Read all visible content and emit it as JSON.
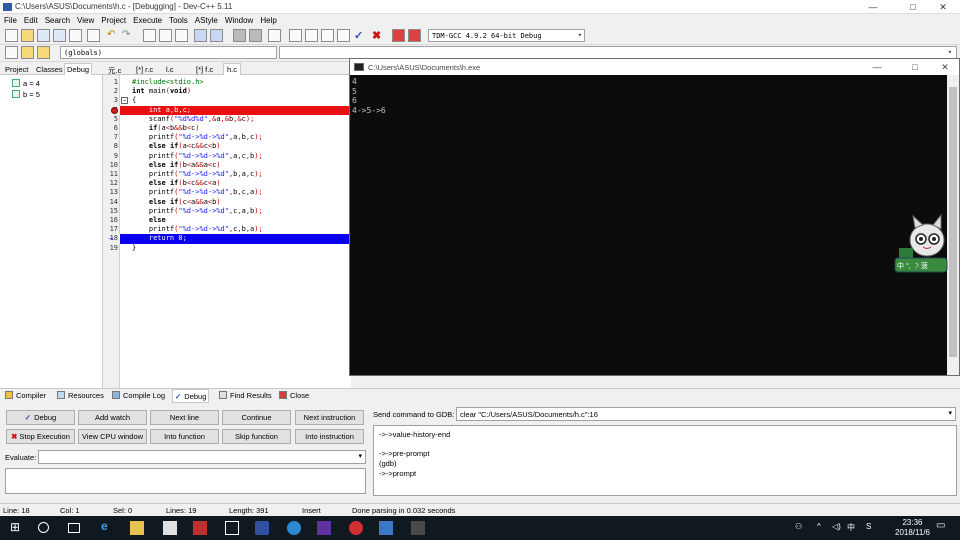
{
  "window": {
    "title": "C:\\Users\\ASUS\\Documents\\h.c - [Debugging] - Dev-C++ 5.11",
    "minimize": "—",
    "maximize": "□",
    "close": "✕"
  },
  "menu": [
    "File",
    "Edit",
    "Search",
    "View",
    "Project",
    "Execute",
    "Tools",
    "AStyle",
    "Window",
    "Help"
  ],
  "toolbar": {
    "compiler": "TDM-GCC 4.9.2 64-bit Debug",
    "scope": "(globals)"
  },
  "left_panel": {
    "tabs": [
      "Project",
      "Classes",
      "Debug"
    ],
    "active_tab": "Debug",
    "watches": [
      "a = 4",
      "b = 5"
    ]
  },
  "editor": {
    "tabs": [
      "元.c",
      "[*] r.c",
      "l.c",
      "[*] f.c",
      "h.c"
    ],
    "active_tab": "h.c",
    "lines": [
      {
        "n": "1",
        "text": "#include<stdio.h>"
      },
      {
        "n": "2",
        "text": "int main(void)"
      },
      {
        "n": "3",
        "text": "{"
      },
      {
        "n": "4",
        "text": "    int a,b,c;"
      },
      {
        "n": "5",
        "text": "    scanf(\"%d%d%d\",&a,&b,&c);"
      },
      {
        "n": "6",
        "text": "    if(a<b&&b<c)"
      },
      {
        "n": "7",
        "text": "    printf(\"%d->%d->%d\",a,b,c);"
      },
      {
        "n": "8",
        "text": "    else if(a<c&&c<b)"
      },
      {
        "n": "9",
        "text": "    printf(\"%d->%d->%d\",a,c,b);"
      },
      {
        "n": "10",
        "text": "    else if(b<a&&a<c)"
      },
      {
        "n": "11",
        "text": "    printf(\"%d->%d->%d\",b,a,c);"
      },
      {
        "n": "12",
        "text": "    else if(b<c&&c<a)"
      },
      {
        "n": "13",
        "text": "    printf(\"%d->%d->%d\",b,c,a);"
      },
      {
        "n": "14",
        "text": "    else if(c<a&&a<b)"
      },
      {
        "n": "15",
        "text": "    printf(\"%d->%d->%d\",c,a,b);"
      },
      {
        "n": "16",
        "text": "    else"
      },
      {
        "n": "17",
        "text": "    printf(\"%d->%d->%d\",c,b,a);"
      },
      {
        "n": "18",
        "text": "    return 0;"
      },
      {
        "n": "19",
        "text": "}"
      }
    ]
  },
  "console": {
    "title": "C:\\Users\\ASUS\\Documents\\h.exe",
    "output": "4\n5\n6\n4->5->6"
  },
  "bottom_panel": {
    "tabs": [
      "Compiler",
      "Resources",
      "Compile Log",
      "Debug",
      "Find Results",
      "Close"
    ],
    "active_tab": "Debug",
    "buttons": {
      "debug": "Debug",
      "add_watch": "Add watch",
      "next_line": "Next line",
      "continue": "Continue",
      "next_instruction": "Next instruction",
      "stop_execution": "Stop Execution",
      "view_cpu": "View CPU window",
      "into_function": "Into function",
      "skip_function": "Skip function",
      "into_instruction": "Into instruction"
    },
    "evaluate_label": "Evaluate:",
    "evaluate_value": "",
    "gdb_label": "Send command to GDB:",
    "gdb_command": "clear \"C:/Users/ASUS/Documents/h.c\":16",
    "gdb_output": "->->value-history-end\n\n->->pre-prompt\n(gdb)\n->->prompt"
  },
  "status": {
    "line": "Line:    18",
    "col": "Col:    1",
    "sel": "Sel:    0",
    "lines": "Lines:    19",
    "length": "Length:    391",
    "mode": "Insert",
    "message": "Done parsing in 0.032 seconds"
  },
  "mascot": {
    "label": "中 °, ☽ 菠"
  },
  "taskbar": {
    "time": "23:36",
    "date": "2018/11/6",
    "ime": "中"
  }
}
